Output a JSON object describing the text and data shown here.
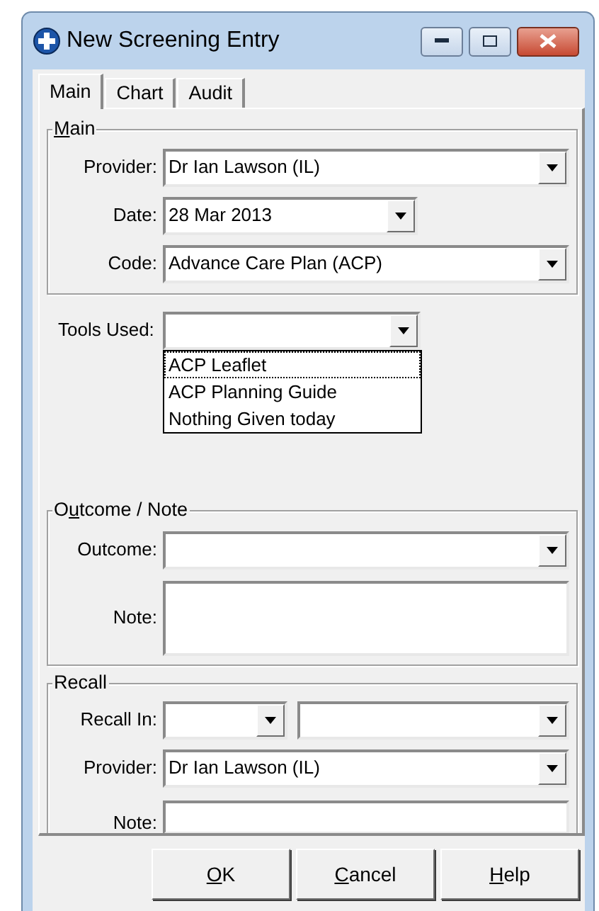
{
  "window": {
    "title": "New Screening Entry"
  },
  "tabs": [
    {
      "label": "Main",
      "selected": true
    },
    {
      "label": "Chart",
      "selected": false
    },
    {
      "label": "Audit",
      "selected": false
    }
  ],
  "main_group": {
    "title": [
      {
        "text": "M",
        "underlined": true
      },
      {
        "text": "ain",
        "underlined": false
      }
    ],
    "fields": [
      {
        "label": "Provider:",
        "value": "Dr Ian Lawson (IL)",
        "kind": "wide"
      },
      {
        "label": "Date:",
        "value": "28 Mar 2013",
        "kind": "narrow"
      },
      {
        "label": "Code:",
        "value": "Advance Care Plan (ACP)",
        "kind": "wide"
      }
    ]
  },
  "tools_used": {
    "label": "Tools Used:",
    "expanded": true,
    "options": [
      {
        "label": "ACP Leaflet",
        "focused": true
      },
      {
        "label": "ACP Planning Guide",
        "focused": false
      },
      {
        "label": "Nothing Given today",
        "focused": false
      }
    ]
  },
  "outcome_group": {
    "title": [
      {
        "text": "O",
        "underlined": false
      },
      {
        "text": "u",
        "underlined": true
      },
      {
        "text": "tcome / Note",
        "underlined": false
      }
    ],
    "outcome_label": "Outcome:",
    "note_label": "Note:"
  },
  "recall_group": {
    "title": [
      {
        "text": "Recall",
        "underlined": false
      }
    ],
    "recall_in_label": "Recall In:",
    "provider_label": "Provider:",
    "provider_value": "Dr Ian Lawson (IL)",
    "note_label": "Note:"
  },
  "buttons": [
    {
      "label": [
        {
          "text": "O",
          "underlined": true
        },
        {
          "text": "K",
          "underlined": false
        }
      ]
    },
    {
      "label": [
        {
          "text": "C",
          "underlined": true
        },
        {
          "text": "ancel",
          "underlined": false
        }
      ]
    },
    {
      "label": [
        {
          "text": "H",
          "underlined": true
        },
        {
          "text": "elp",
          "underlined": false
        }
      ]
    }
  ]
}
